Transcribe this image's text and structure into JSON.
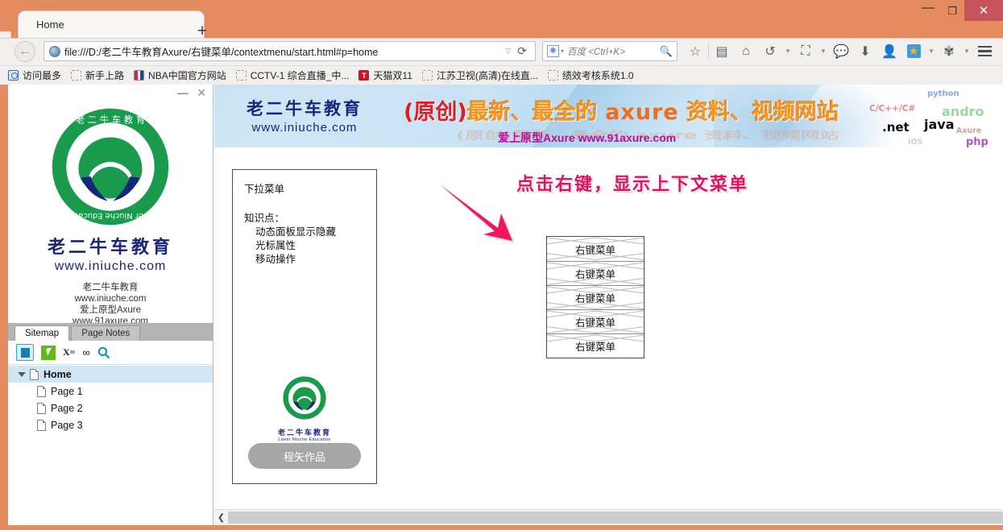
{
  "window": {
    "minimize_label": "—",
    "maximize_label": "❐",
    "close_label": "✕"
  },
  "tabs": {
    "active_title": "Home",
    "new_tab_label": "+"
  },
  "navbar": {
    "back_label": "←",
    "url": "file:///D:/老二牛车教育Axure/右键菜单/contextmenu/start.html#p=home",
    "url_dropdown": "▽",
    "reload_label": "⟳",
    "search_engine": "baidu-paw-icon",
    "search_placeholder": "百度 <Ctrl+K>",
    "icons": [
      {
        "name": "bookmark-star-icon",
        "glyph": "☆"
      },
      {
        "name": "reading-list-icon",
        "glyph": "▤"
      },
      {
        "name": "home-icon",
        "glyph": "⌂"
      },
      {
        "name": "history-back-icon",
        "glyph": "↺"
      },
      {
        "name": "screenshot-icon",
        "glyph": "⛶"
      },
      {
        "name": "chat-bubble-icon",
        "glyph": "💬"
      },
      {
        "name": "download-icon",
        "glyph": "⬇"
      },
      {
        "name": "account-icon",
        "glyph": "👤"
      },
      {
        "name": "favorites-gold-star-icon",
        "glyph": "★"
      },
      {
        "name": "extension-icon",
        "glyph": "✾"
      },
      {
        "name": "menu-hamburger-icon",
        "glyph": "≡"
      }
    ]
  },
  "bookmarks": [
    {
      "label": "访问最多",
      "icon": "most-visited-icon"
    },
    {
      "label": "新手上路",
      "icon": "placeholder-icon"
    },
    {
      "label": "NBA中国官方网站",
      "icon": "nba-icon"
    },
    {
      "label": "CCTV-1 综合直播_中...",
      "icon": "placeholder-icon"
    },
    {
      "label": "天猫双11",
      "icon": "tmall-icon"
    },
    {
      "label": "江苏卫视(高清)在线直...",
      "icon": "placeholder-icon"
    },
    {
      "label": "绩效考核系统1.0",
      "icon": "placeholder-icon"
    }
  ],
  "axure_panel": {
    "minimize_label": "—",
    "close_label": "✕",
    "brand_cn": "老二牛车教育",
    "brand_url": "www.iniuche.com",
    "info_lines": [
      "老二牛车教育",
      "www.iniuche.com",
      "爱上原型Axure",
      "www.91axure.com"
    ],
    "tabs": [
      {
        "label": "Sitemap",
        "active": true
      },
      {
        "label": "Page Notes",
        "active": false
      }
    ],
    "toolbar_icons": [
      {
        "name": "page-view-icon",
        "active": true
      },
      {
        "name": "annotation-cursor-icon",
        "active": false
      },
      {
        "name": "variables-x-equals-icon",
        "label": "X=",
        "active": false
      },
      {
        "name": "links-icon",
        "label": "∞",
        "active": false
      },
      {
        "name": "search-icon",
        "label": "🔍",
        "active": false
      }
    ],
    "tree": [
      {
        "label": "Home",
        "level": 0,
        "selected": true,
        "expanded": true
      },
      {
        "label": "Page 1",
        "level": 1,
        "selected": false
      },
      {
        "label": "Page 2",
        "level": 1,
        "selected": false
      },
      {
        "label": "Page 3",
        "level": 1,
        "selected": false
      }
    ]
  },
  "banner": {
    "brand_cn": "老二牛车教育",
    "brand_url": "www.iniuche.com",
    "headline_red": "(原创)",
    "headline_orange_1": "最新、最全的",
    "headline_axure": "axure",
    "headline_orange_2": "资料、视频网站",
    "ghost_text": "(原创)最新、最全的 axure 资料、视频网站",
    "subtitle": "爱上原型Axure  www.91axure.com",
    "tags": {
      "python": "python",
      "cpp": "C/C++/C#",
      "android": "andro",
      "dotnet": ".net",
      "java": "java",
      "axure": "Axure",
      "php": "php",
      "ios": "IOS"
    }
  },
  "prototype": {
    "infobox": {
      "title": "下拉菜单",
      "knowledge_label": "知识点：",
      "knowledge_points": [
        "动态面板显示隐藏",
        "光标属性",
        "移动操作"
      ],
      "logo_cn": "老二牛车教育",
      "logo_en": "Laoer Niuche Education",
      "button_label": "程矢作品"
    },
    "headline": "点击右键，显示上下文菜单",
    "arrow": "arrow-pointing-down-right",
    "menu_items": [
      "右键菜单",
      "右键菜单",
      "右键菜单",
      "右键菜单",
      "右键菜单"
    ]
  },
  "scrollbar": {
    "left_arrow": "❮"
  },
  "colors": {
    "window_frame": "#e58b60",
    "close_button": "#c7545c",
    "headline_pink": "#e0115f",
    "arrow_pink": "#f3145e",
    "brand_navy": "#17267c",
    "logo_green": "#199a4c",
    "banner_orange": "#f7941e",
    "banner_red": "#e8191f",
    "selected_row": "#cfe6f5"
  }
}
